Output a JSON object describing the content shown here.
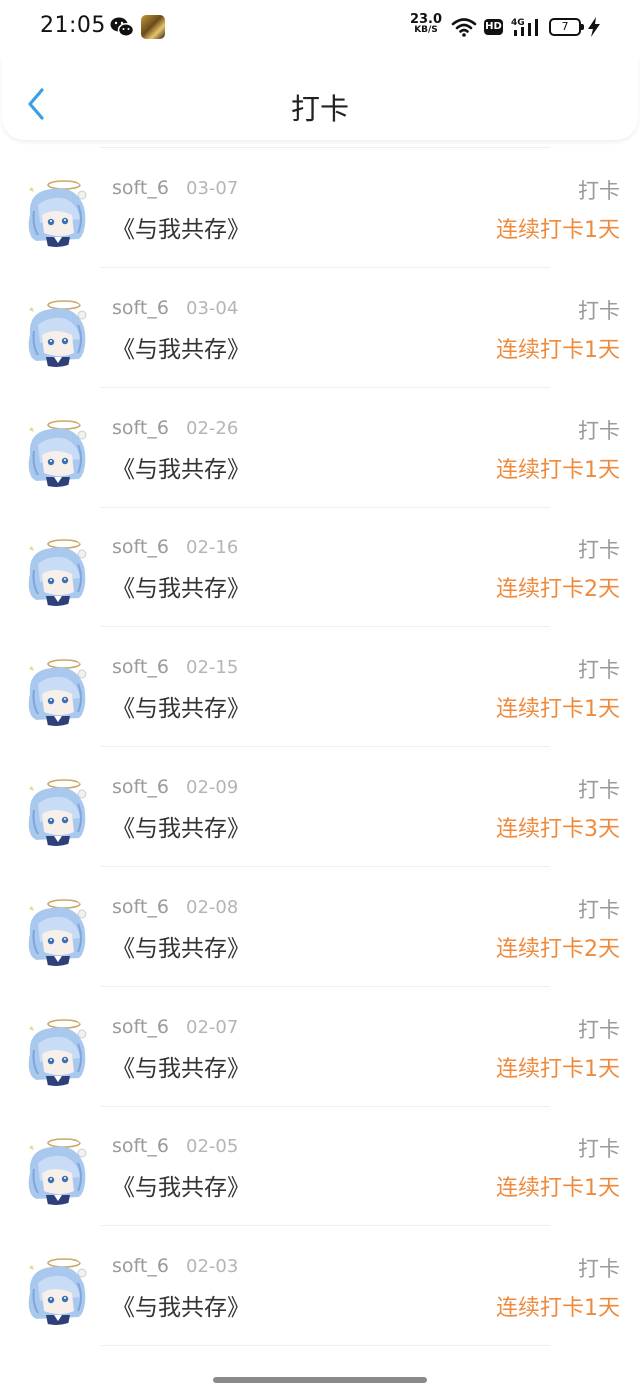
{
  "status_bar": {
    "time": "21:05",
    "net_speed": "23.0",
    "net_unit": "KB/S",
    "hd_label": "HD",
    "signal_label": "4G",
    "battery": "7",
    "icons": [
      "wechat-icon",
      "app-icon",
      "wifi-icon",
      "hd-icon",
      "signal-icon",
      "battery-icon",
      "charging-icon"
    ]
  },
  "nav": {
    "back_icon": "chevron-left-icon",
    "title": "打卡"
  },
  "colors": {
    "streak": "#ef8a3c",
    "back": "#3aa0e6",
    "muted": "#9a9a9a"
  },
  "records": [
    {
      "user": "soft_6",
      "date": "03-07",
      "book": "《与我共存》",
      "action": "打卡",
      "streak": "连续打卡1天"
    },
    {
      "user": "soft_6",
      "date": "03-04",
      "book": "《与我共存》",
      "action": "打卡",
      "streak": "连续打卡1天"
    },
    {
      "user": "soft_6",
      "date": "02-26",
      "book": "《与我共存》",
      "action": "打卡",
      "streak": "连续打卡1天"
    },
    {
      "user": "soft_6",
      "date": "02-16",
      "book": "《与我共存》",
      "action": "打卡",
      "streak": "连续打卡2天"
    },
    {
      "user": "soft_6",
      "date": "02-15",
      "book": "《与我共存》",
      "action": "打卡",
      "streak": "连续打卡1天"
    },
    {
      "user": "soft_6",
      "date": "02-09",
      "book": "《与我共存》",
      "action": "打卡",
      "streak": "连续打卡3天"
    },
    {
      "user": "soft_6",
      "date": "02-08",
      "book": "《与我共存》",
      "action": "打卡",
      "streak": "连续打卡2天"
    },
    {
      "user": "soft_6",
      "date": "02-07",
      "book": "《与我共存》",
      "action": "打卡",
      "streak": "连续打卡1天"
    },
    {
      "user": "soft_6",
      "date": "02-05",
      "book": "《与我共存》",
      "action": "打卡",
      "streak": "连续打卡1天"
    },
    {
      "user": "soft_6",
      "date": "02-03",
      "book": "《与我共存》",
      "action": "打卡",
      "streak": "连续打卡1天"
    }
  ]
}
